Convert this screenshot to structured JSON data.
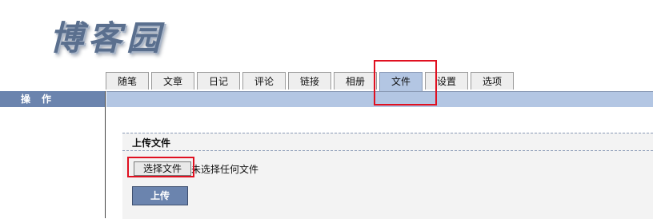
{
  "logo": {
    "text": "博客园"
  },
  "tabs": [
    {
      "label": "随笔"
    },
    {
      "label": "文章"
    },
    {
      "label": "日记"
    },
    {
      "label": "评论"
    },
    {
      "label": "链接"
    },
    {
      "label": "相册"
    },
    {
      "label": "文件",
      "active": true
    },
    {
      "label": "设置"
    },
    {
      "label": "选项"
    }
  ],
  "sidebar": {
    "header": "操作"
  },
  "upload": {
    "title": "上传文件",
    "choose_label": "选择文件",
    "no_file_text": "未选择任何文件",
    "submit_label": "上传"
  },
  "colors": {
    "accent": "#6b84ae",
    "tab_active": "#b3c6e3",
    "highlight": "#e01020"
  }
}
